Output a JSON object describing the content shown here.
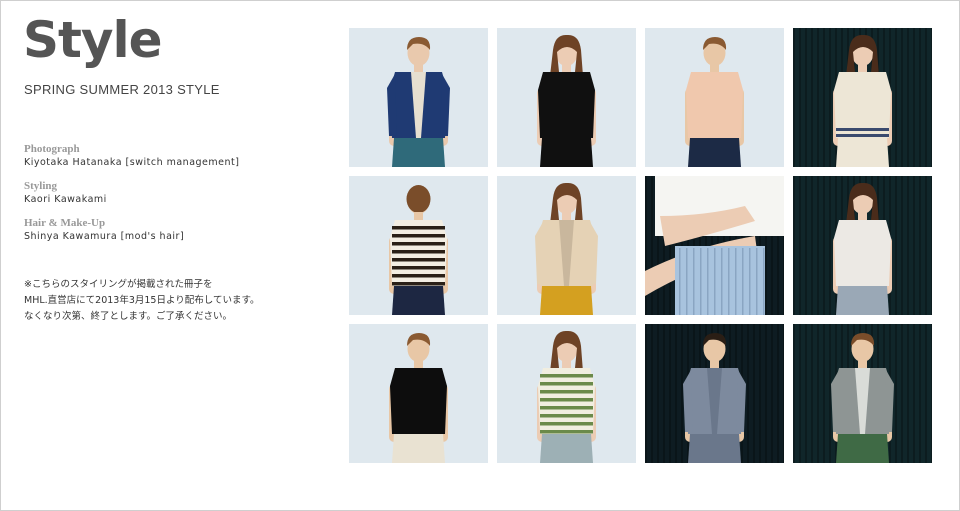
{
  "header": {
    "title": "Style",
    "subtitle": "SPRING SUMMER 2013 STYLE"
  },
  "credits": [
    {
      "role": "Photograph",
      "name": "Kiyotaka Hatanaka [switch management]"
    },
    {
      "role": "Styling",
      "name": "Kaori Kawakami"
    },
    {
      "role": "Hair & Make-Up",
      "name": "Shinya Kawamura [mod's hair]"
    }
  ],
  "note": {
    "lines": [
      "※こちらのスタイリングが掲載された冊子を",
      "MHL.直営店にて2013年3月15日より配布しています。",
      "なくなり次第、終了とします。ご了承ください。"
    ]
  },
  "photos": [
    {
      "id": "look-01",
      "bg": "#dfe8ee",
      "subject": "man",
      "top": "#1f3a73",
      "top2": "#e6dfd0",
      "bottom": "#2f6a7a",
      "skin": "#e9c9ad",
      "hair": "#8a5a32",
      "pattern": "cardigan"
    },
    {
      "id": "look-02",
      "bg": "#dfe8ee",
      "subject": "woman",
      "top": "#101010",
      "top2": "#101010",
      "bottom": "#101010",
      "skin": "#ecccb4",
      "hair": "#6e4326",
      "pattern": "plain"
    },
    {
      "id": "look-03",
      "bg": "#dfe8ee",
      "subject": "man",
      "top": "#f0c8ad",
      "top2": "#f0c8ad",
      "bottom": "#1c2a45",
      "skin": "#e8c7a6",
      "hair": "#8a5a32",
      "pattern": "plain"
    },
    {
      "id": "look-04",
      "bg": "#10262a",
      "subject": "woman",
      "top": "#ede6d6",
      "top2": "#ede6d6",
      "bottom": "#ede6d6",
      "skin": "#ecccb4",
      "hair": "#4a2c1b",
      "pattern": "hem-stripe"
    },
    {
      "id": "look-05",
      "bg": "#dfe8ee",
      "subject": "man-back",
      "top": "#f3eee3",
      "top2": "#2a2017",
      "bottom": "#1d2742",
      "skin": "#e8c7a6",
      "hair": "#7a4d2a",
      "pattern": "stripes"
    },
    {
      "id": "look-06",
      "bg": "#dfe8ee",
      "subject": "woman",
      "top": "#e5d2b5",
      "top2": "#c9b79d",
      "bottom": "#d4a020",
      "skin": "#ecccb4",
      "hair": "#6e4326",
      "pattern": "cardigan"
    },
    {
      "id": "look-07",
      "bg": "#0e1c22",
      "subject": "closeup",
      "top": "#f5f5f2",
      "top2": "#f5f5f2",
      "bottom": "#a8c3de",
      "skin": "#ecccb4",
      "hair": "#4a2c1b",
      "pattern": "plain"
    },
    {
      "id": "look-08",
      "bg": "#10262a",
      "subject": "woman",
      "top": "#ece9e4",
      "top2": "#ece9e4",
      "bottom": "#9aa8b6",
      "skin": "#ecccb4",
      "hair": "#4a2c1b",
      "pattern": "plain"
    },
    {
      "id": "look-09",
      "bg": "#dfe8ee",
      "subject": "man",
      "top": "#0d0d0d",
      "top2": "#0d0d0d",
      "bottom": "#e9e2d2",
      "skin": "#e8c7a6",
      "hair": "#8a5a32",
      "pattern": "plain"
    },
    {
      "id": "look-10",
      "bg": "#dfe8ee",
      "subject": "woman",
      "top": "#f1eee0",
      "top2": "#6b8a4a",
      "bottom": "#9db0b5",
      "skin": "#ecccb4",
      "hair": "#6e4326",
      "pattern": "stripes"
    },
    {
      "id": "look-11",
      "bg": "#0e1c22",
      "subject": "man-jacket",
      "top": "#7d8a9e",
      "top2": "#6a778b",
      "bottom": "#6a778b",
      "skin": "#e8c7a6",
      "hair": "#2a1e15",
      "pattern": "jacket"
    },
    {
      "id": "look-12",
      "bg": "#10262a",
      "subject": "man",
      "top": "#8e9594",
      "top2": "#d9dcd8",
      "bottom": "#3f6a45",
      "skin": "#e8c7a6",
      "hair": "#7a4d2a",
      "pattern": "jacket"
    }
  ]
}
